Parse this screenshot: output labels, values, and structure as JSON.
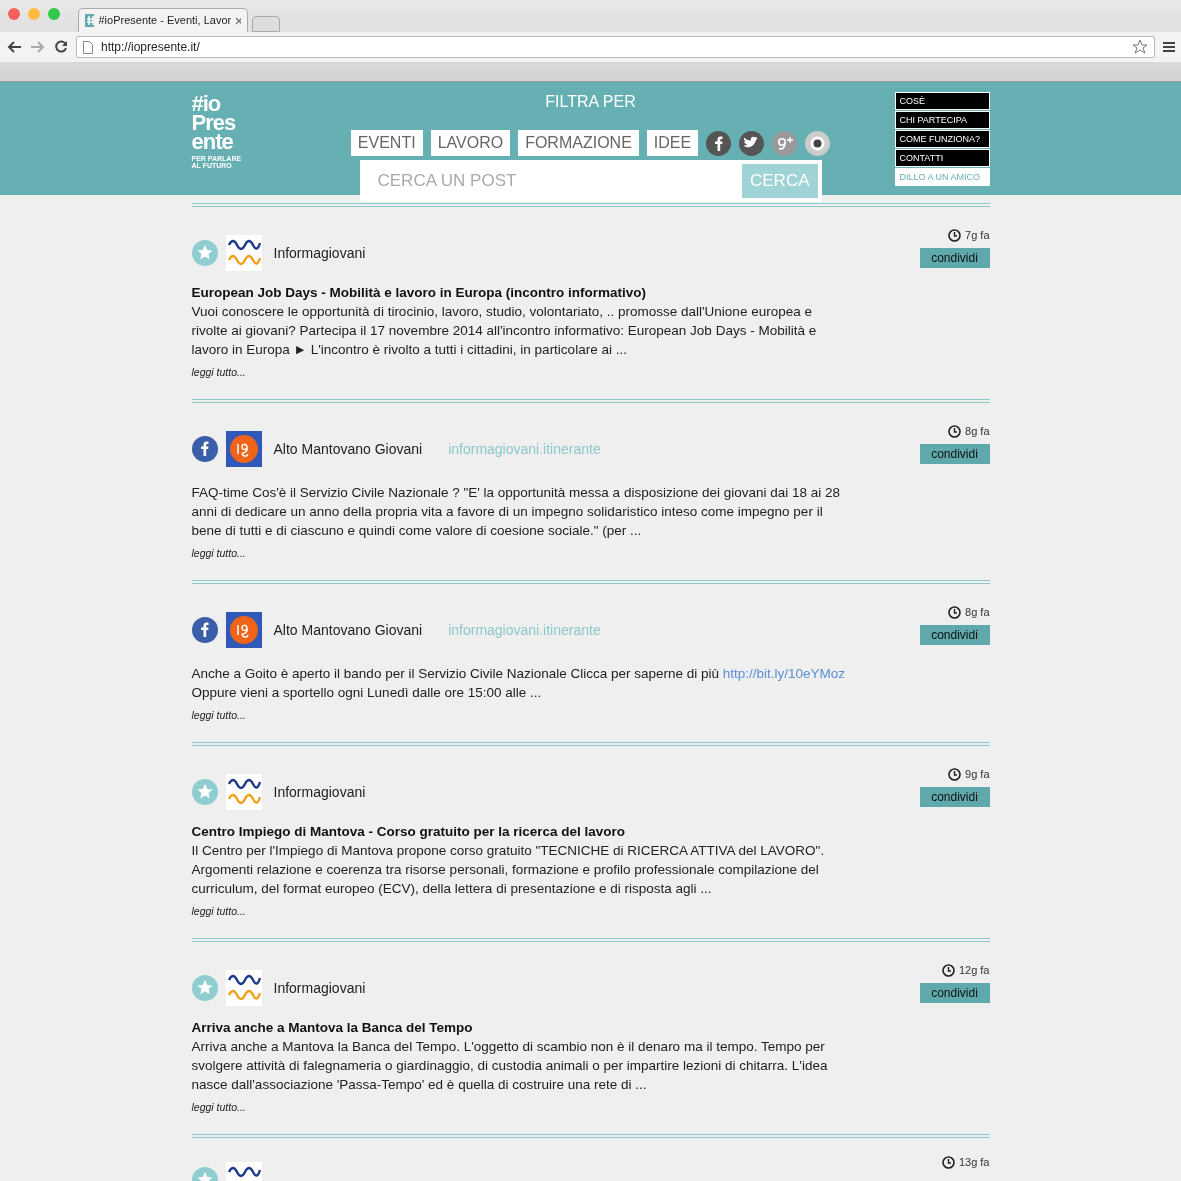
{
  "browser": {
    "tab_title": "#ioPresente - Eventi, Lavor",
    "url": "http://iopresente.it/"
  },
  "logo": {
    "lines": [
      "#io",
      "Pres",
      "ente"
    ],
    "tagline": [
      "PER PARLARE",
      "AL FUTURO"
    ]
  },
  "filter": {
    "title": "FILTRA PER",
    "buttons": [
      "EVENTI",
      "LAVORO",
      "FORMAZIONE",
      "IDEE"
    ],
    "social": [
      {
        "kind": "facebook"
      },
      {
        "kind": "twitter"
      },
      {
        "kind": "googleplus"
      },
      {
        "kind": "instagram"
      }
    ]
  },
  "search": {
    "placeholder": "CERCA UN POST",
    "button": "CERCA"
  },
  "menu": [
    {
      "label": "COSÈ",
      "kind": "dark"
    },
    {
      "label": "CHI PARTECIPA",
      "kind": "dark"
    },
    {
      "label": "COME FUNZIONA?",
      "kind": "dark"
    },
    {
      "label": "CONTATTI",
      "kind": "dark"
    },
    {
      "label": "DILLO A UN AMICO",
      "kind": "light"
    }
  ],
  "posts": [
    {
      "source": {
        "kind": "star"
      },
      "logo": {
        "kind": "informa"
      },
      "author": "Informagiovani",
      "time": "7g fa",
      "share": "condividi",
      "title": "European Job Days - Mobilità e lavoro in Europa (incontro informativo)",
      "body": "Vuoi conoscere le opportunità di tirocinio, lavoro, studio, volontariato, .. promosse dall'Unione europea e rivolte ai giovani? Partecipa il 17 novembre 2014 all'incontro informativo: European Job Days - Mobilità e lavoro in Europa ► L'incontro è rivolto a tutti i cittadini, in particolare ai ...",
      "more": "leggi tutto..."
    },
    {
      "source": {
        "kind": "facebook"
      },
      "logo": {
        "kind": "ig"
      },
      "author": "Alto Mantovano Giovani",
      "page": "informagiovani.itinerante",
      "time": "8g fa",
      "share": "condividi",
      "body": "FAQ-time Cos'è il Servizio Civile Nazionale ? \"E' la opportunità messa a disposizione dei giovani dai 18 ai 28 anni di dedicare un anno della propria vita a favore di un impegno solidaristico inteso come impegno per il bene di tutti e di ciascuno e quindi come valore di coesione sociale.\" (per ...",
      "more": "leggi tutto..."
    },
    {
      "source": {
        "kind": "facebook"
      },
      "logo": {
        "kind": "ig"
      },
      "author": "Alto Mantovano Giovani",
      "page": "informagiovani.itinerante",
      "time": "8g fa",
      "share": "condividi",
      "body": "Anche a Goito è aperto il bando per il Servizio Civile Nazionale Clicca per saperne di più",
      "link": "http://bit.ly/10eYMoz",
      "body_end": "Oppure vieni a sportello ogni Lunedì dalle ore 15:00 alle ...",
      "more": "leggi tutto..."
    },
    {
      "source": {
        "kind": "star"
      },
      "logo": {
        "kind": "informa"
      },
      "author": "Informagiovani",
      "time": "9g fa",
      "share": "condividi",
      "title": "Centro Impiego di Mantova - Corso gratuito per la ricerca del lavoro",
      "body": "Il Centro per l'Impiego di Mantova propone corso gratuito \"TECNICHE di RICERCA ATTIVA del LAVORO\". Argomenti relazione e coerenza tra risorse personali, formazione e profilo professionale compilazione del curriculum, del format europeo (ECV), della lettera di presentazione e di risposta agli ...",
      "more": "leggi tutto..."
    },
    {
      "source": {
        "kind": "star"
      },
      "logo": {
        "kind": "informa"
      },
      "author": "Informagiovani",
      "time": "12g fa",
      "share": "condividi",
      "title": "Arriva anche a Mantova la Banca del Tempo",
      "body": "Arriva anche a Mantova la Banca del Tempo. L'oggetto di scambio non è il denaro ma il tempo. Tempo per svolgere attività di falegnameria o giardinaggio, di custodia animali o per impartire lezioni di chitarra. L'idea nasce dall'associazione 'Passa-Tempo' ed è quella di costruire una rete di ...",
      "more": "leggi tutto..."
    },
    {
      "source": {
        "kind": "star"
      },
      "logo": {
        "kind": "informa"
      },
      "time": "13g fa"
    }
  ]
}
